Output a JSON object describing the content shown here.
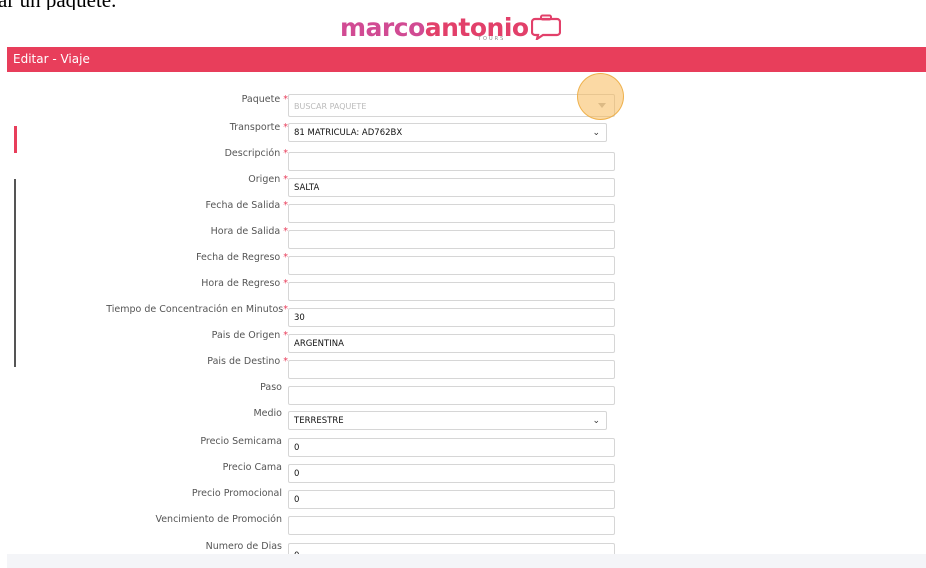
{
  "caption": "ar un paquete.",
  "brand": {
    "word_a": "marco",
    "word_b": "antonio",
    "tagline": "TOURS",
    "color_a": "#d14b93",
    "color_b": "#e2406a",
    "accent": "#e83e5b"
  },
  "header": {
    "title": "Editar - Viaje"
  },
  "form": {
    "paquete": {
      "label": "Paquete",
      "placeholder": "BUSCAR PAQUETE"
    },
    "transporte": {
      "label": "Transporte",
      "value": "81 MATRICULA: AD762BX"
    },
    "descripcion": {
      "label": "Descripción",
      "value": ""
    },
    "origen": {
      "label": "Origen",
      "value": "SALTA"
    },
    "fecha_salida": {
      "label": "Fecha de Salida",
      "value": ""
    },
    "hora_salida": {
      "label": "Hora de Salida",
      "value": ""
    },
    "fecha_regreso": {
      "label": "Fecha de Regreso",
      "value": ""
    },
    "hora_regreso": {
      "label": "Hora de Regreso",
      "value": ""
    },
    "tiempo_concentracion": {
      "label": "Tiempo de Concentración en Minutos",
      "value": "30"
    },
    "pais_origen": {
      "label": "Pais de Origen",
      "value": "ARGENTINA"
    },
    "pais_destino": {
      "label": "Pais de Destino",
      "value": ""
    },
    "paso": {
      "label": "Paso",
      "value": ""
    },
    "medio": {
      "label": "Medio",
      "value": "TERRESTRE"
    },
    "precio_semicama": {
      "label": "Precio Semicama",
      "value": "0"
    },
    "precio_cama": {
      "label": "Precio Cama",
      "value": "0"
    },
    "precio_promocional": {
      "label": "Precio Promocional",
      "value": "0"
    },
    "vencimiento_promocion": {
      "label": "Vencimiento de Promoción",
      "value": ""
    },
    "numero_dias": {
      "label": "Numero de Dias",
      "value": "0"
    }
  },
  "required_marker": "*",
  "icons": {
    "logo": "suitcase-chat-icon",
    "dropdown": "chevron-down-icon",
    "search_dropdown": "caret-down-icon"
  }
}
